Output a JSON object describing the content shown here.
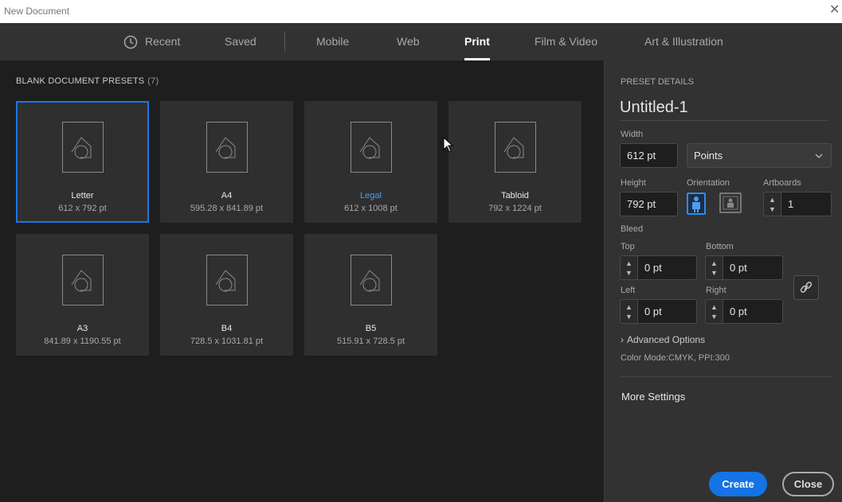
{
  "window": {
    "title": "New Document",
    "close_glyph": "✕"
  },
  "tabs": {
    "recent": "Recent",
    "saved": "Saved",
    "mobile": "Mobile",
    "web": "Web",
    "print": "Print",
    "film": "Film & Video",
    "art": "Art & Illustration"
  },
  "presets": {
    "heading": "BLANK DOCUMENT PRESETS",
    "count": "(7)",
    "items": [
      {
        "name": "Letter",
        "dims": "612 x 792 pt"
      },
      {
        "name": "A4",
        "dims": "595.28 x 841.89 pt"
      },
      {
        "name": "Legal",
        "dims": "612 x 1008 pt"
      },
      {
        "name": "Tabloid",
        "dims": "792 x 1224 pt"
      },
      {
        "name": "A3",
        "dims": "841.89 x 1190.55 pt"
      },
      {
        "name": "B4",
        "dims": "728.5 x 1031.81 pt"
      },
      {
        "name": "B5",
        "dims": "515.91 x 728.5 pt"
      }
    ]
  },
  "details": {
    "heading": "PRESET DETAILS",
    "doc_name": "Untitled-1",
    "width_label": "Width",
    "width_value": "612 pt",
    "units_value": "Points",
    "height_label": "Height",
    "height_value": "792 pt",
    "orientation_label": "Orientation",
    "artboards_label": "Artboards",
    "artboards_value": "1",
    "bleed_label": "Bleed",
    "top_label": "Top",
    "top_value": "0 pt",
    "bottom_label": "Bottom",
    "bottom_value": "0 pt",
    "left_label": "Left",
    "left_value": "0 pt",
    "right_label": "Right",
    "right_value": "0 pt",
    "advanced": "Advanced Options",
    "color_mode": "Color Mode:CMYK, PPI:300",
    "more_settings": "More Settings",
    "create": "Create",
    "close": "Close"
  },
  "colors": {
    "accent": "#1473e6",
    "selected_border": "#1e74e6",
    "link": "#4d9cf3"
  }
}
